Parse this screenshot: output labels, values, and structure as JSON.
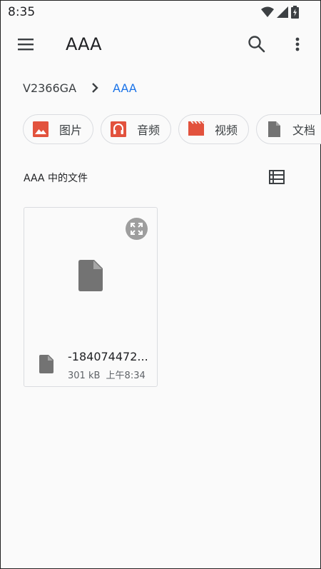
{
  "status_bar": {
    "time": "8:35",
    "icons": [
      "wifi-icon",
      "signal-icon",
      "battery-charging-icon"
    ]
  },
  "app_bar": {
    "title": "AAA",
    "icons": [
      "menu-icon",
      "search-icon",
      "more-vert-icon"
    ]
  },
  "breadcrumb": {
    "root": "V2366GA",
    "current": "AAA"
  },
  "chips": [
    {
      "label": "图片",
      "icon": "image-icon",
      "color": "#e2523d"
    },
    {
      "label": "音频",
      "icon": "headphones-icon",
      "color": "#e2523d"
    },
    {
      "label": "视频",
      "icon": "movie-icon",
      "color": "#e2523d"
    },
    {
      "label": "文档",
      "icon": "document-icon",
      "color": "#737373"
    }
  ],
  "section": {
    "title": "AAA 中的文件",
    "view_toggle_icon": "list-view-icon"
  },
  "files": [
    {
      "name": "-184074472...",
      "size": "301 kB",
      "time": "上午8:34",
      "icon": "file-icon"
    }
  ],
  "colors": {
    "accent": "#1a73e8",
    "chip_icon": "#e2523d",
    "file_icon": "#737373"
  }
}
